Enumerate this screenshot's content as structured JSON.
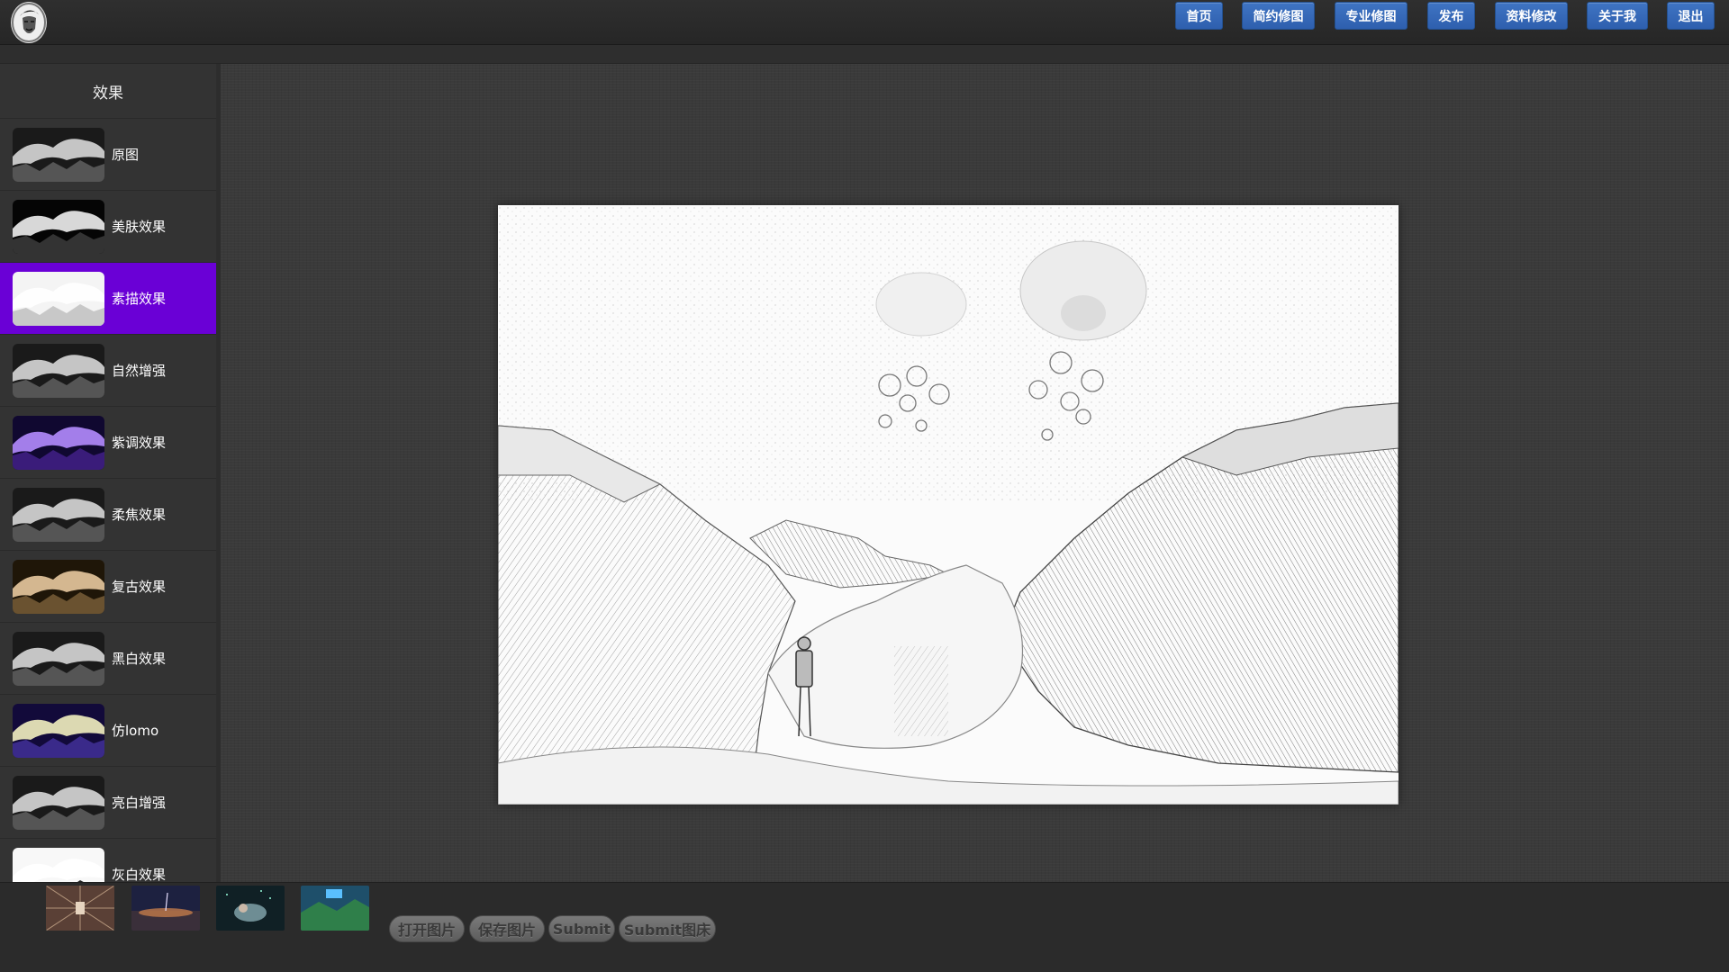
{
  "nav": {
    "buttons": [
      "首页",
      "简约修图",
      "专业修图",
      "发布",
      "资料修改",
      "关于我",
      "退出"
    ]
  },
  "sidebar": {
    "title": "效果",
    "items": [
      {
        "label": "原图",
        "tone": "gray"
      },
      {
        "label": "美肤效果",
        "tone": "dark"
      },
      {
        "label": "素描效果",
        "tone": "sketch",
        "active": true
      },
      {
        "label": "自然增强",
        "tone": "gray"
      },
      {
        "label": "紫调效果",
        "tone": "purple"
      },
      {
        "label": "柔焦效果",
        "tone": "gray"
      },
      {
        "label": "复古效果",
        "tone": "sepia"
      },
      {
        "label": "黑白效果",
        "tone": "gray"
      },
      {
        "label": "仿lomo",
        "tone": "lomo"
      },
      {
        "label": "亮白增强",
        "tone": "gray"
      },
      {
        "label": "灰白效果",
        "tone": "bright"
      }
    ],
    "active_color": "#6a00d6"
  },
  "toolbar": {
    "open_label": "打开图片",
    "save_label": "保存图片",
    "submit_label": "Submit",
    "submit_bed_label": "Submit图床"
  },
  "colors": {
    "nav_button": "#3a6cbd",
    "background": "#3a3a3a"
  }
}
